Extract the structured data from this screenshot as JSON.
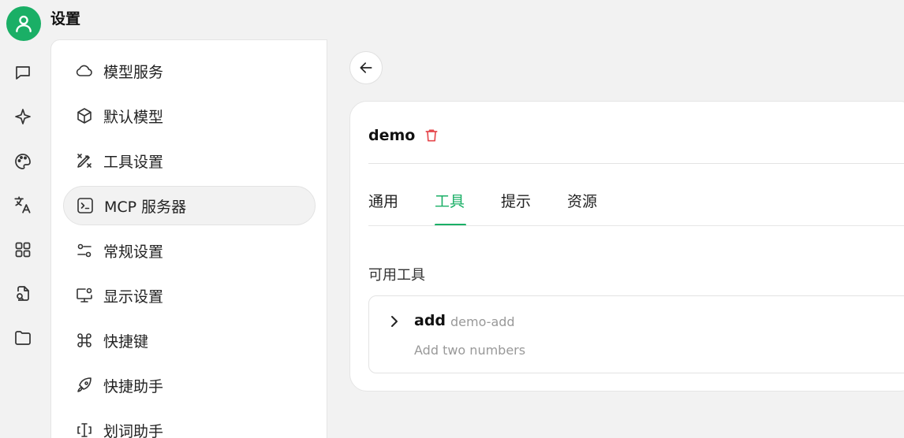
{
  "header": {
    "title": "设置"
  },
  "rail": {
    "items": [
      "chat-icon",
      "sparkle-icon",
      "palette-icon",
      "translate-icon",
      "apps-grid-icon",
      "file-search-icon",
      "folder-icon"
    ]
  },
  "menu": {
    "items": [
      {
        "label": "模型服务",
        "icon": "cloud-icon"
      },
      {
        "label": "默认模型",
        "icon": "cube-icon"
      },
      {
        "label": "工具设置",
        "icon": "tools-icon"
      },
      {
        "label": "MCP 服务器",
        "icon": "terminal-icon",
        "active": true
      },
      {
        "label": "常规设置",
        "icon": "sliders-icon"
      },
      {
        "label": "显示设置",
        "icon": "monitor-settings-icon"
      },
      {
        "label": "快捷键",
        "icon": "command-icon"
      },
      {
        "label": "快捷助手",
        "icon": "rocket-icon"
      },
      {
        "label": "划词助手",
        "icon": "text-select-icon"
      }
    ]
  },
  "server": {
    "name": "demo",
    "tabs": [
      "通用",
      "工具",
      "提示",
      "资源"
    ],
    "active_tab": "工具",
    "section_title": "可用工具",
    "tools": [
      {
        "name": "add",
        "id": "demo-add",
        "description": "Add two numbers"
      }
    ]
  },
  "colors": {
    "accent": "#1aaf66",
    "danger": "#e5484d"
  }
}
